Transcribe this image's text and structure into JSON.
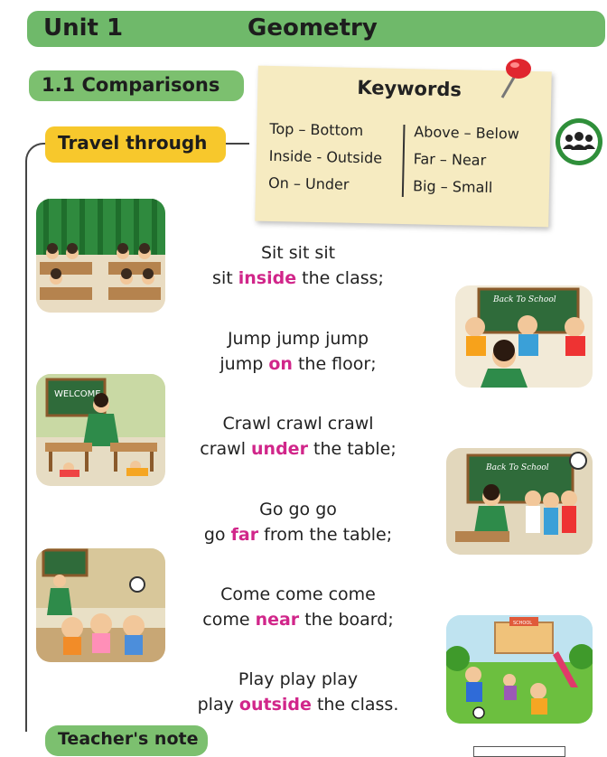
{
  "unit": {
    "number": "Unit 1",
    "title": "Geometry"
  },
  "section": {
    "title": "1.1 Comparisons"
  },
  "keywords": {
    "title": "Keywords",
    "left": [
      "Top – Bottom",
      "Inside - Outside",
      "On – Under"
    ],
    "right": [
      "Above – Below",
      "Far – Near",
      "Big – Small"
    ]
  },
  "activity": {
    "label": "Travel through",
    "icon": "group-people-icon"
  },
  "poem": [
    {
      "line1": "Sit sit sit",
      "pre": "sit",
      "word": "inside",
      "post": "the class;"
    },
    {
      "line1": "Jump jump jump",
      "pre": "jump",
      "word": "on",
      "post": "the floor;"
    },
    {
      "line1": "Crawl crawl crawl",
      "pre": "crawl",
      "word": "under",
      "post": "the table;"
    },
    {
      "line1": "Go go go",
      "pre": "go",
      "word": "far",
      "post": "from the table;"
    },
    {
      "line1": "Come come come",
      "pre": "come",
      "word": "near",
      "post": "the board;"
    },
    {
      "line1": "Play play play",
      "pre": "play",
      "word": "outside",
      "post": "the class."
    }
  ],
  "scenes": {
    "back_to_school_1": "Back To School",
    "welcome": "WELCOME",
    "back_to_school_2": "Back To School",
    "school_sign": "SCHOOL"
  },
  "teacher_note": {
    "label": "Teacher's note"
  },
  "colors": {
    "green": "#6fb96a",
    "yellow": "#f7c82c",
    "highlight": "#d1268a",
    "note": "#f6ebc1"
  }
}
